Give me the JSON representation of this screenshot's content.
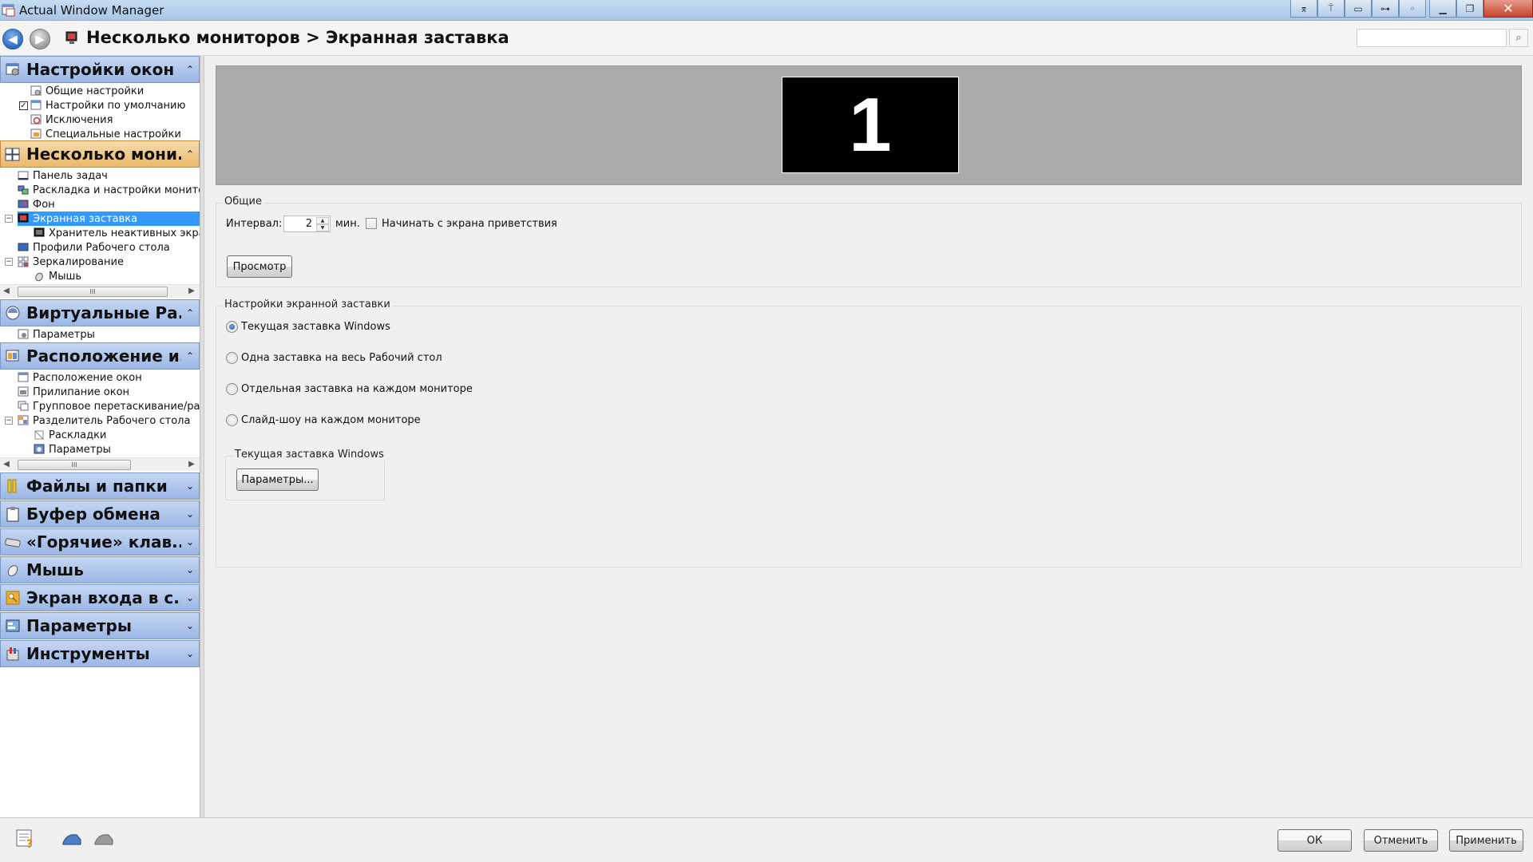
{
  "window": {
    "title": "Actual Window Manager"
  },
  "nav": {
    "breadcrumb": "Несколько мониторов > Экранная заставка",
    "search_placeholder": ""
  },
  "sidebar": {
    "groups": [
      {
        "label": "Настройки окон",
        "items": [
          "Общие настройки",
          "Настройки по умолчанию",
          "Исключения",
          "Специальные настройки"
        ]
      },
      {
        "label": "Несколько мони...",
        "items": [
          "Панель задач",
          "Раскладка и настройки монитор",
          "Фон",
          "Экранная заставка",
          "Хранитель неактивных экран",
          "Профили Рабочего стола",
          "Зеркалирование",
          "Мышь"
        ]
      },
      {
        "label": "Виртуальные Ра...",
        "items": [
          "Параметры"
        ]
      },
      {
        "label": "Расположение и...",
        "items": [
          "Расположение окон",
          "Прилипание окон",
          "Групповое перетаскивание/ра",
          "Разделитель Рабочего стола",
          "Раскладки",
          "Параметры"
        ]
      },
      {
        "label": "Файлы и папки",
        "items": []
      },
      {
        "label": "Буфер обмена",
        "items": []
      },
      {
        "label": "«Горячие» клав...",
        "items": []
      },
      {
        "label": "Мышь",
        "items": []
      },
      {
        "label": "Экран входа в с...",
        "items": []
      },
      {
        "label": "Параметры",
        "items": []
      },
      {
        "label": "Инструменты",
        "items": []
      }
    ],
    "scroll_thumb": "III"
  },
  "main": {
    "monitor_number": "1",
    "general": {
      "legend": "Общие",
      "interval_label": "Интервал:",
      "interval_value": "2",
      "interval_unit": "мин.",
      "welcome_label": "Начинать с экрана приветствия",
      "welcome_checked": false,
      "preview_button": "Просмотр"
    },
    "screensaver": {
      "legend": "Настройки экранной заставки",
      "options": [
        "Текущая заставка Windows",
        "Одна заставка на весь Рабочий стол",
        "Отдельная заставка на каждом мониторе",
        "Слайд-шоу на каждом мониторе"
      ],
      "selected": 0,
      "sub_legend": "Текущая заставка Windows",
      "params_button": "Параметры..."
    }
  },
  "footer": {
    "ok": "ОК",
    "cancel": "Отменить",
    "apply": "Применить"
  },
  "colors": {
    "selection": "#3399ff",
    "group_blue": "#9bb7e6",
    "group_orange": "#ebb869"
  }
}
